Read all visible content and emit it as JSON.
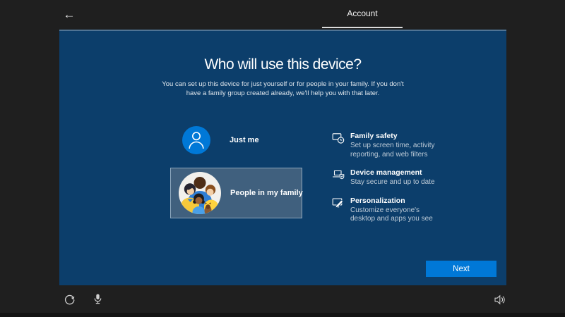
{
  "window": {
    "back_icon": "←",
    "tab_label": "Account"
  },
  "header": {
    "title": "Who will use this device?",
    "subtitle": "You can set up this device for just yourself or for people in your family. If you don't have a family group created already, we'll help you with that later."
  },
  "options": [
    {
      "label": "Just me",
      "selected": false,
      "icon": "person-icon"
    },
    {
      "label": "People in my family",
      "selected": true,
      "icon": "family-illustration"
    }
  ],
  "features": [
    {
      "title": "Family safety",
      "description": "Set up screen time, activity reporting, and web filters",
      "icon": "screen-clock-icon"
    },
    {
      "title": "Device management",
      "description": "Stay secure and up to date",
      "icon": "laptop-shield-icon"
    },
    {
      "title": "Personalization",
      "description": "Customize everyone's desktop and apps you see",
      "icon": "screen-pencil-icon"
    }
  ],
  "footer": {
    "next_label": "Next"
  },
  "system_bar": {
    "left_icons": [
      "ease-of-access-icon",
      "microphone-icon"
    ],
    "right_icons": [
      "volume-icon"
    ]
  },
  "colors": {
    "accent": "#0078d7",
    "panel_blue": "#0c3e6b",
    "selected_card_bg": "#40607e",
    "frame_dark": "#1f1f1f"
  }
}
